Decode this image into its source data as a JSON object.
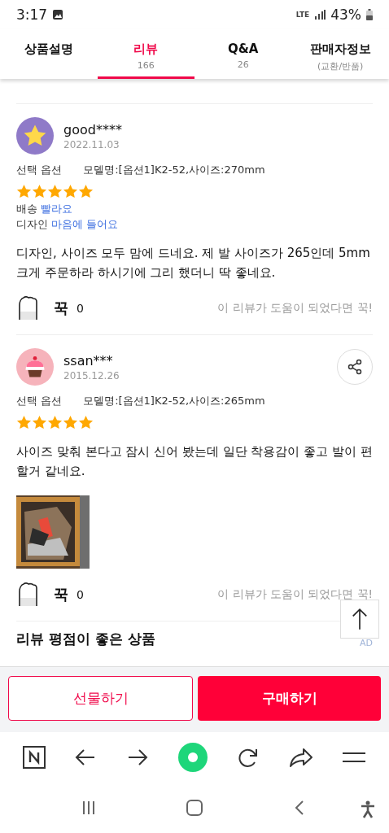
{
  "status_bar": {
    "time": "3:17",
    "network": "LTE",
    "battery": "43%"
  },
  "tabs": [
    {
      "label": "상품설명",
      "selected": false
    },
    {
      "label": "리뷰",
      "sub": "166",
      "selected": true
    },
    {
      "label": "Q&A",
      "sub": "26",
      "selected": false
    },
    {
      "label": "판매자정보",
      "sub": "(교환/반품)",
      "selected": false
    }
  ],
  "reviews": [
    {
      "user": "good****",
      "date": "2022.11.03",
      "share": false,
      "option_label": "선택 옵션",
      "option": "모델명:[옵션1]K2-52,사이즈:270mm",
      "stars": 5,
      "tags": [
        {
          "label": "배송",
          "value": "빨라요"
        },
        {
          "label": "디자인",
          "value": "마음에 들어요"
        }
      ],
      "text": "디자인, 사이즈 모두 맘에 드네요. 제 발 사이즈가 265인데 5mm크게 주문하라 하시기에 그리 했더니 딱 좋네요.",
      "photo": false,
      "like_label": "꾹",
      "like_count": "0",
      "like_hint": "이 리뷰가 도움이 되었다면 꾹!"
    },
    {
      "user": "ssan***",
      "date": "2015.12.26",
      "share": true,
      "option_label": "선택 옵션",
      "option": "모델명:[옵션1]K2-52,사이즈:265mm",
      "stars": 5,
      "text": "사이즈 맞춰 본다고 잠시 신어 봤는데 일단 착용감이 좋고 발이 편할거 같네요.",
      "photo": true,
      "like_label": "꾹",
      "like_count": "0",
      "like_hint": "이 리뷰가 도움이 되었다면 꾹!"
    }
  ],
  "section_title": "리뷰 평점이 좋은 상품",
  "ad_label": "AD",
  "actions": [
    {
      "label": "선물하기",
      "kind": "outline"
    },
    {
      "label": "구매하기",
      "kind": "primary"
    }
  ]
}
